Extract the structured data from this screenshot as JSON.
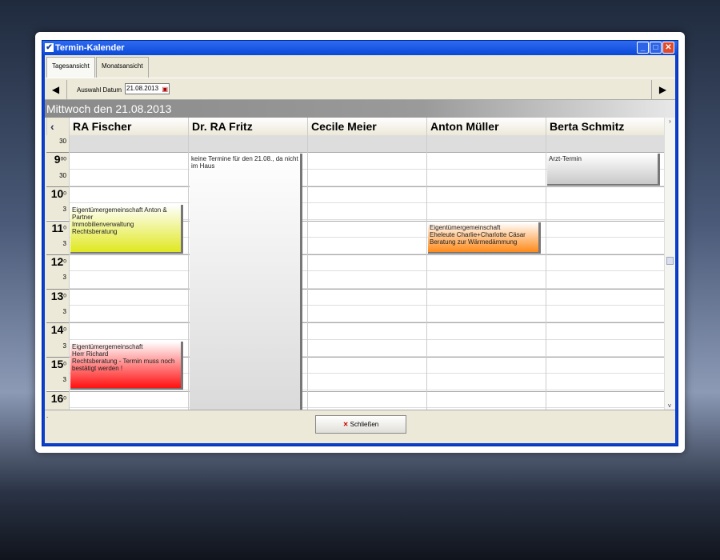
{
  "window": {
    "title": "Termin-Kalender"
  },
  "tabs": [
    {
      "label": "Tagesansicht"
    },
    {
      "label": "Monatsansicht"
    }
  ],
  "nav": {
    "date_label": "Auswahl Datum",
    "date_value": "21.08.2013",
    "prev_icon": "triangle-left",
    "next_icon": "triangle-right"
  },
  "day_banner": "Mittwoch den 21.08.2013",
  "columns": [
    "RA Fischer",
    "Dr. RA Fritz",
    "Cecile Meier",
    "Anton Müller",
    "Berta Schmitz"
  ],
  "times": [
    [
      "30",
      ""
    ],
    [
      "9",
      "00"
    ],
    [
      "30",
      ""
    ],
    [
      "10",
      "0"
    ],
    [
      "3",
      ""
    ],
    [
      "11",
      "0"
    ],
    [
      "3",
      ""
    ],
    [
      "12",
      "0"
    ],
    [
      "3",
      ""
    ],
    [
      "13",
      "0"
    ],
    [
      "3",
      ""
    ],
    [
      "14",
      "0"
    ],
    [
      "3",
      ""
    ],
    [
      "15",
      "0"
    ],
    [
      "3",
      ""
    ],
    [
      "16",
      "0"
    ],
    [
      "",
      ""
    ]
  ],
  "appointments": [
    {
      "col": 0,
      "start": 4,
      "end": 7,
      "text": "Eigentümergemeinschaft Anton & Partner\nImmobilienverwaltung\nRechtsberatung",
      "color": "#e0e820"
    },
    {
      "col": 1,
      "start": 1,
      "end": 17,
      "text": "keine Termine für den 21.08., da nicht im Haus",
      "color": "#d8d8d8"
    },
    {
      "col": 3,
      "start": 5,
      "end": 7,
      "text": "Eigentümergemeinschaft\nEheleute Charlie+Charlotte Cäsar\nBeratung zur Wärmedämmung",
      "color": "#ff8a1a"
    },
    {
      "col": 4,
      "start": 1,
      "end": 3,
      "text": "Arzt-Termin",
      "color": "#c8c8c8"
    },
    {
      "col": 0,
      "start": 12,
      "end": 15,
      "text": "Eigentümergemeinschaft\nHerr Richard\nRechtsberatung - Termin muss noch bestätigt werden !",
      "color": "#ff1010"
    }
  ],
  "status_text": ".",
  "close_button": {
    "label": "Schließen",
    "icon": "x-icon"
  }
}
